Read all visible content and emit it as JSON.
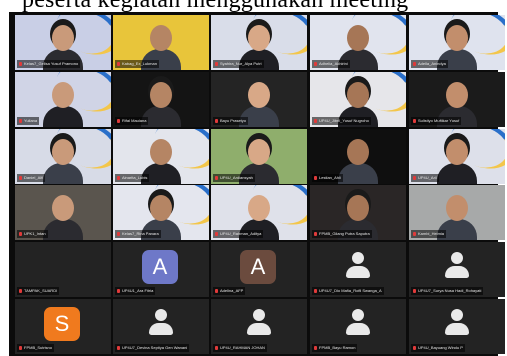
{
  "caption": "peserta kegiatan menggunakan meeting",
  "tiles": [
    {
      "name": "Kelas7_Gelisa Yusuf Pramono",
      "kind": "video",
      "bg": "#c9cfe6"
    },
    {
      "name": "Kabag_Ex_Lukman",
      "kind": "video",
      "bg": "#e8c53a"
    },
    {
      "name": "Syahira_Nur_Alya Putri",
      "kind": "video",
      "bg": "#d9dde9"
    },
    {
      "name": "Adhelia_Akhirini",
      "kind": "video",
      "bg": "#e1e4ee"
    },
    {
      "name": "Adella_Anindya",
      "kind": "video",
      "bg": "#dfe3ee"
    },
    {
      "name": "Yuliana",
      "kind": "video",
      "bg": "#d0d4e6"
    },
    {
      "name": "Rifal Maulana",
      "kind": "video",
      "bg": "#141414"
    },
    {
      "name": "Bayu Prasetyo",
      "kind": "video",
      "bg": "#242424"
    },
    {
      "name": "UP4U_Jibril_Yusuf Nugroho",
      "kind": "video",
      "bg": "#e6e6ea"
    },
    {
      "name": "Sulistiyo Muftikar Yusuf",
      "kind": "video",
      "bg": "#1b1b1b"
    },
    {
      "name": "Daniel_Alfi",
      "kind": "video",
      "bg": "#d7dbe7"
    },
    {
      "name": "Ainarita_Lubis",
      "kind": "video",
      "bg": "#e3e5ec"
    },
    {
      "name": "UP4U_Ardiansyah",
      "kind": "video",
      "bg": "#8fae6c"
    },
    {
      "name": "Lestian_Ahli",
      "kind": "video",
      "bg": "#0f0f0f"
    },
    {
      "name": "UP4U_Aril",
      "kind": "video",
      "bg": "#dde0ea"
    },
    {
      "name": "UPK1_Intan",
      "kind": "video",
      "bg": "#5a554e"
    },
    {
      "name": "Kelas7_Rina Panara",
      "kind": "video",
      "bg": "#e4e6ee"
    },
    {
      "name": "UP4U_Rahman_Aditya",
      "kind": "video",
      "bg": "#dfe1ea"
    },
    {
      "name": "FPMB_Gilang Putra Saputra",
      "kind": "video",
      "bg": "#2a2626"
    },
    {
      "name": "Kambi_Helmia",
      "kind": "video",
      "bg": "#a7a9a9"
    },
    {
      "name": "TAMPAK_SUARDI",
      "kind": "blank",
      "bg": "#0b0b0b"
    },
    {
      "name": "UP4U1_Ara Fitria",
      "kind": "letter",
      "letter": "A",
      "color": "#6e78c8"
    },
    {
      "name": "Adelina_AFP",
      "kind": "letter",
      "letter": "A",
      "color": "#6b4b3e"
    },
    {
      "name": "UP4U7_Dio Mafia_Rofil Swanga_A",
      "kind": "generic"
    },
    {
      "name": "UP4U7_Surya Nusa Hadi_Rohayati",
      "kind": "generic"
    },
    {
      "name": "FPMB_Sutrisno",
      "kind": "letter",
      "letter": "S",
      "color": "#f07a1e"
    },
    {
      "name": "UP4U7_Devina Septiya Gen Wanani",
      "kind": "generic"
    },
    {
      "name": "UP4U_RAHMAN JOHAN",
      "kind": "generic"
    },
    {
      "name": "FPMB_Bayu Ramon",
      "kind": "generic"
    },
    {
      "name": "UP4U_Bayuang Windu P",
      "kind": "generic"
    }
  ],
  "colors": {
    "grid_background": "#0b0b0b",
    "mic_muted": "#e03a3a"
  }
}
